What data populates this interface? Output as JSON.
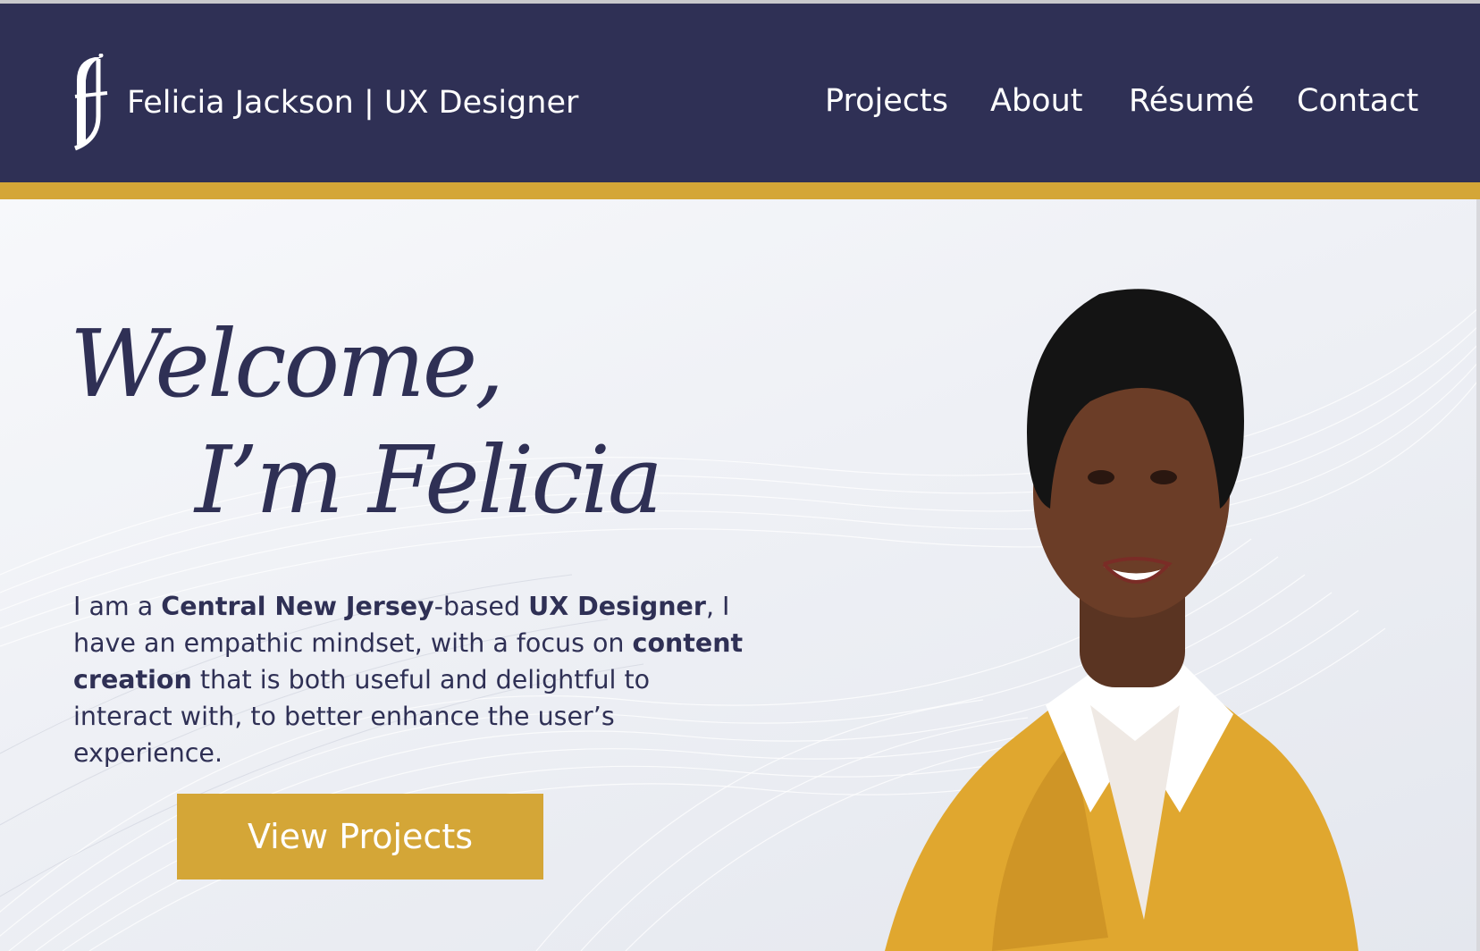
{
  "header": {
    "logo_icon": "fj-monogram-icon",
    "brand_title": "Felicia Jackson | UX Designer",
    "nav": {
      "projects": "Projects",
      "about": "About",
      "resume": "Résumé",
      "contact": "Contact"
    }
  },
  "hero": {
    "welcome_line1": "Welcome,",
    "welcome_line2": "I’m Felicia",
    "intro": {
      "t1": "I am a ",
      "b1": "Central New Jersey",
      "t2": "-based ",
      "b2": "UX Designer",
      "t3": ", I have an empathic mindset, with a focus on ",
      "b3": "content creation",
      "t4": " that is both useful and delightful to interact with, to better enhance the user’s experience."
    },
    "cta_label": "View Projects",
    "portrait_icon": "portrait-photo"
  },
  "colors": {
    "navy": "#2f3055",
    "gold": "#d4a637",
    "white": "#ffffff",
    "hero_bg": "#eef0f5"
  }
}
